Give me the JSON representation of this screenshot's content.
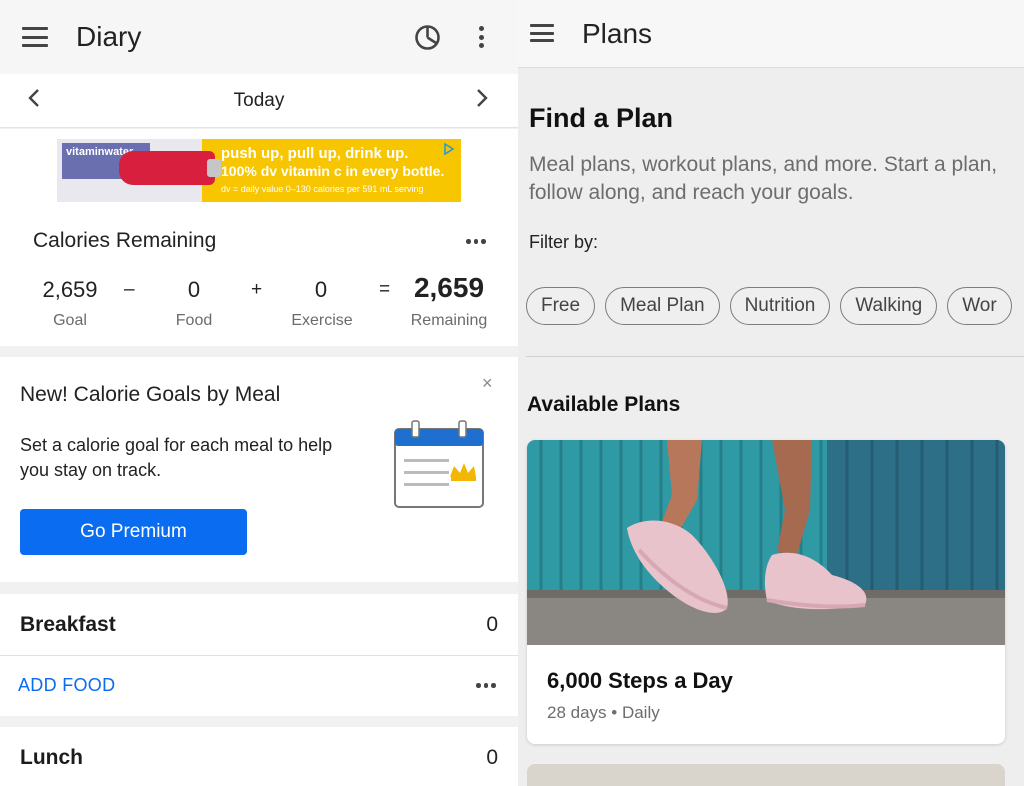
{
  "diary": {
    "title": "Diary",
    "date_nav": {
      "label": "Today"
    },
    "ad": {
      "brand": "vitaminwater",
      "line1": "push up, pull up, drink up.",
      "line2": "100% dv vitamin c in every bottle.",
      "fine_print": "dv = daily value     0–130 calories per 591 mL serving"
    },
    "calories": {
      "title": "Calories Remaining",
      "goal_value": "2,659",
      "goal_label": "Goal",
      "minus": "–",
      "food_value": "0",
      "food_label": "Food",
      "plus": "+",
      "exercise_value": "0",
      "exercise_label": "Exercise",
      "equals": "=",
      "remaining_value": "2,659",
      "remaining_label": "Remaining"
    },
    "promo": {
      "title": "New! Calorie Goals by Meal",
      "body": "Set a calorie goal for each meal to help you stay on track.",
      "button": "Go Premium",
      "close": "×"
    },
    "meals": {
      "breakfast": {
        "name": "Breakfast",
        "calories": "0",
        "add_food": "ADD FOOD"
      },
      "lunch": {
        "name": "Lunch",
        "calories": "0"
      }
    }
  },
  "plans": {
    "title": "Plans",
    "heading": "Find a Plan",
    "description": "Meal plans, workout plans, and more. Start a plan, follow along, and reach your goals.",
    "filter_label": "Filter by:",
    "filters": [
      "Free",
      "Meal Plan",
      "Nutrition",
      "Walking",
      "Wor"
    ],
    "available_heading": "Available Plans",
    "card": {
      "title": "6,000 Steps a Day",
      "meta": "28 days • Daily"
    }
  },
  "colors": {
    "accent": "#0a6cf0",
    "ad_yellow": "#f7c600",
    "wall_teal": "#2f9aa4",
    "shoe_pink": "#e9c3cc"
  },
  "icons": [
    "menu-icon",
    "pie-chart-icon",
    "more-vert-icon",
    "chevron-left-icon",
    "chevron-right-icon",
    "more-horiz-icon",
    "close-icon",
    "calendar-crown-icon"
  ]
}
